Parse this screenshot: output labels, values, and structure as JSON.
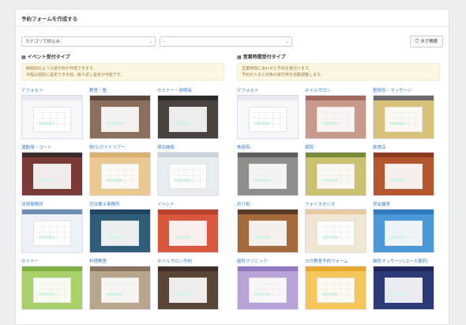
{
  "panel": {
    "title": "予約フォームを作成する"
  },
  "filters": {
    "category_value": "カテゴリで絞込み",
    "sub_value": "-",
    "tag_button": "タグ検索"
  },
  "columns": [
    {
      "title": "イベント受付タイプ",
      "note_line1": "時間割のような受付枠が作成できます。",
      "note_line2": "日程は個別に設定できる他、繰り返し設定が可能です。",
      "templates": [
        {
          "label": "デフォルト",
          "bg": "#f6f7f8",
          "bar": "#e6e9ee",
          "cal": true
        },
        {
          "label": "教室・塾",
          "bg": "#8a6f5c",
          "bar": "#5a463a",
          "cal": true
        },
        {
          "label": "セミナー・説明会",
          "bg": "#4a4440",
          "bar": "#2c2a28",
          "cal": true
        },
        {
          "label": "運動場・コート",
          "bg": "#7a3a36",
          "bar": "#3b2a2a",
          "cal": true
        },
        {
          "label": "旅行/ガイドツアー",
          "bg": "#e9c98f",
          "bar": "#d8b070",
          "cal": true
        },
        {
          "label": "宿泊施設",
          "bg": "#e7ecef",
          "bar": "#c9d3d9",
          "cal": true
        },
        {
          "label": "法律事務所",
          "bg": "#eef2f6",
          "bar": "#6c8eb0",
          "cal": true
        },
        {
          "label": "司法書士事務所",
          "bg": "#2f5e7a",
          "bar": "#1f4560",
          "cal": true
        },
        {
          "label": "イベント",
          "bg": "#d9583d",
          "bar": "#b8432c",
          "cal": true
        },
        {
          "label": "セミナー",
          "bg": "#a9d06a",
          "bar": "#7fb043",
          "cal": true
        },
        {
          "label": "料理教室",
          "bg": "#b9a48c",
          "bar": "#8a7560",
          "cal": true
        },
        {
          "label": "ネイルサロン予約",
          "bg": "#5a4636",
          "bar": "#3d2f24",
          "cal": true
        }
      ]
    },
    {
      "title": "営業時間受付タイプ",
      "note_line1": "営業時間にあわせた予約を受付けます。",
      "note_line2": "予約が入ると前後の受付枠を自動調整します。",
      "templates": [
        {
          "label": "デフォルト",
          "bg": "#f6f7f8",
          "bar": "#e6e9ee",
          "cal": true
        },
        {
          "label": "ネイルサロン",
          "bg": "#c79a8c",
          "bar": "#a3695e",
          "cal": true
        },
        {
          "label": "整体院・マッサージ",
          "bg": "#d8c27a",
          "bar": "#6a6a6a",
          "cal": true
        },
        {
          "label": "美容院",
          "bg": "#8c8f8a",
          "bar": "#5d5f5c",
          "cal": true
        },
        {
          "label": "病院",
          "bg": "#c9c070",
          "bar": "#7b8a3a",
          "cal": true
        },
        {
          "label": "飲食店",
          "bg": "#b5572e",
          "bar": "#8a3c1e",
          "cal": true
        },
        {
          "label": "めり松",
          "bg": "#a46a3c",
          "bar": "#5a3a28",
          "cal": true
        },
        {
          "label": "フォトスタジオ",
          "bg": "#f0e7d2",
          "bar": "#e5c9a0",
          "cal": true
        },
        {
          "label": "貸会議室",
          "bg": "#4a98d6",
          "bar": "#2f7bbd",
          "cal": true
        },
        {
          "label": "歯科クリニック",
          "bg": "#b8a2d8",
          "bar": "#9179bf",
          "cal": true
        },
        {
          "label": "ヨガ教室予約フォーム",
          "bg": "#f5c65a",
          "bar": "#e6a82d",
          "cal": true
        },
        {
          "label": "婦色マッサージ(コース選択)",
          "bg": "#2c3a78",
          "bar": "#1f2858",
          "cal": true
        }
      ]
    }
  ]
}
